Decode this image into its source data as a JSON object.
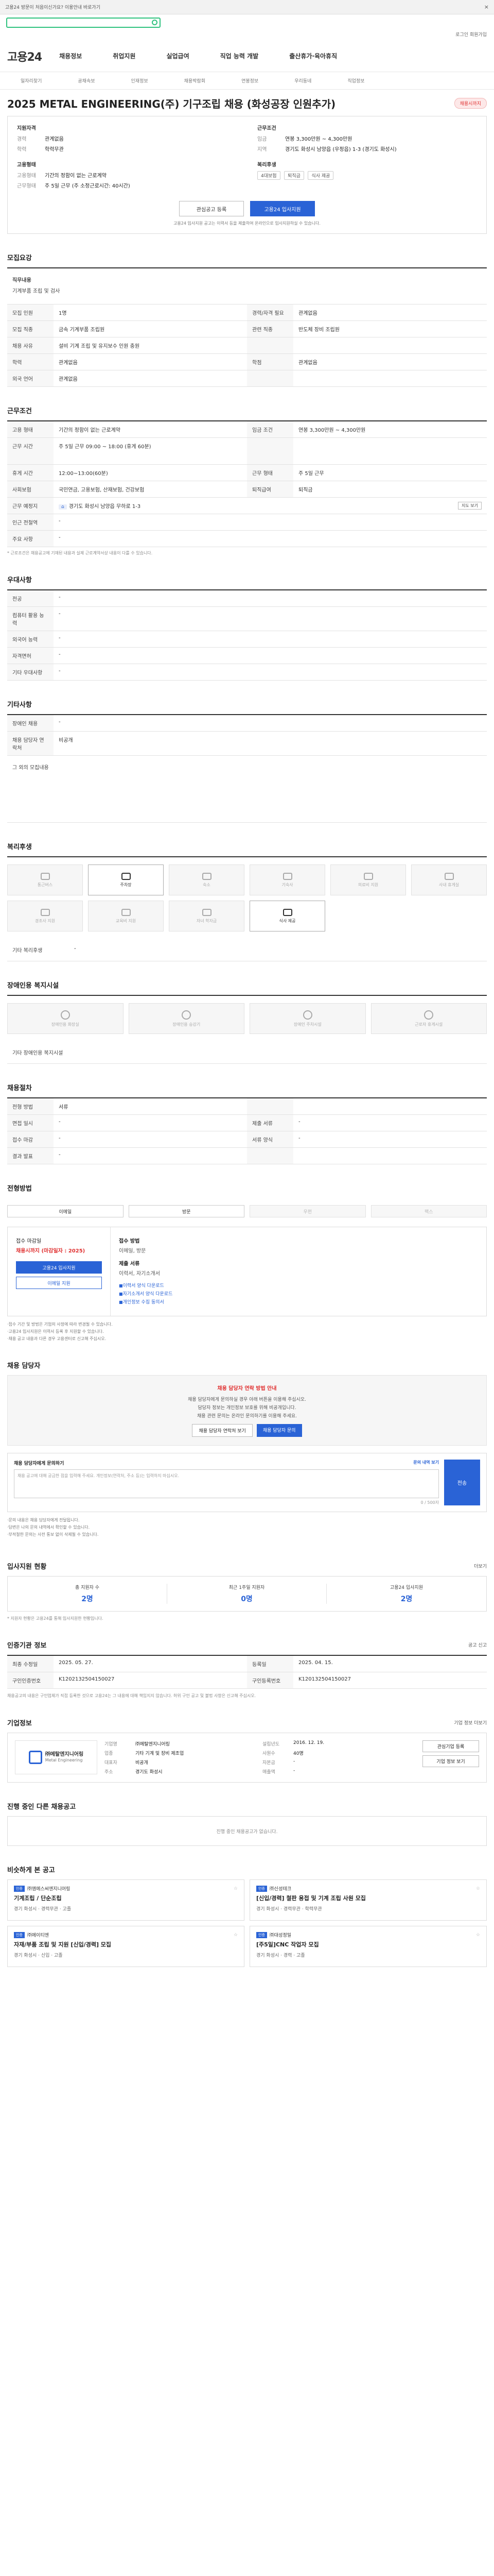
{
  "top": {
    "banner": "고용24 방문이 처음이신가요? 이용안내 바로가기",
    "util": "로그인   회원가입"
  },
  "brand": {
    "name": "고용24"
  },
  "gnb": [
    "채용정보",
    "취업지원",
    "실업급여",
    "직업 능력 개발",
    "출산휴가·육아휴직"
  ],
  "subnav": [
    "일자리찾기",
    "공채속보",
    "인재정보",
    "채용박람회",
    "연봉정보",
    "우리동네",
    "직업정보"
  ],
  "job": {
    "title": "2025 METAL ENGINEERING(주) 기구조립 채용 (화성공장 인원추가)",
    "status_badge": "채용시까지",
    "summary": {
      "left_head": "지원자격",
      "career_k": "경력",
      "career_v": "관계없음",
      "edu_k": "학력",
      "edu_v": "학력무관",
      "cond_head": "고용형태",
      "type_k": "고용형태",
      "type_v": "기간의 정함이 없는 근로계약",
      "hours_k": "근무형태",
      "hours_v": "주 5일 근무 (주 소정근로시간: 40시간)",
      "right_head": "근무조건",
      "pay_k": "임금",
      "pay_v": "연봉 3,300만원 ~ 4,300만원",
      "loc_k": "지역",
      "loc_v": "경기도 화성시 남양읍 (우정읍) 1-3 (경기도 화성시)",
      "welfare_head": "복리후생",
      "welfare_pills": [
        "4대보험",
        "퇴직금",
        "식사 제공"
      ]
    },
    "btn_scrap": "관심공고 등록",
    "btn_apply": "고용24 입사지원",
    "apply_note": "고용24 입사지원 공고는 이력서 등을 제출하여 온라인으로 입사지원하실 수 있습니다."
  },
  "sections": {
    "duty": "모집요강",
    "duty_head": "직무내용",
    "duty_text": "기계부품 조립 및 검사",
    "conditions": "근무조건",
    "preferred": "우대사항",
    "etc": "기타사항",
    "welfare": "복리후생",
    "disability": "장애인용 복지시설",
    "recruitment": "채용절차",
    "method": "전형방법",
    "manager": "채용 담당자",
    "stats": "입사지원 현황",
    "info": "인증기관 정보",
    "company": "기업정보",
    "related": "진행 중인 다른 채용공고",
    "similar": "비슷하게 본 공고"
  },
  "duty_rows": [
    [
      "모집 인원",
      "1명",
      "경력/자격 필요",
      "관계없음"
    ],
    [
      "모집 직종",
      "금속 기계부품 조립원",
      "관련 직종",
      "반도체 장비 조립원"
    ],
    [
      "채용 사유",
      "설비 기계 조립 및 유지보수 인원 충원",
      "",
      ""
    ],
    [
      "학력",
      "관계없음",
      "학점",
      "관계없음"
    ],
    [
      "외국 언어",
      "관계없음",
      "",
      ""
    ]
  ],
  "cond_rows": [
    [
      "고용 형태",
      "기간의 정함이 없는 근로계약",
      "임금 조건",
      "연봉 3,300만원 ~ 4,300만원"
    ],
    [
      "근무 시간",
      "주 5일 근무 09:00 ~ 18:00 (휴게 60분)",
      "",
      ""
    ],
    [
      "휴게 시간",
      "12:00~13:00(60분)",
      "근무 형태",
      "주 5일 근무"
    ],
    [
      "사회보험",
      "국민연금, 고용보험, 산재보험, 건강보험",
      "퇴직급여",
      "퇴직금"
    ]
  ],
  "loc_row": {
    "k": "근무 예정지",
    "v": "경기도 화성시 남양읍 무하로 1-3",
    "map": "지도 보기"
  },
  "cond_extra": [
    [
      "인근 전철역",
      "-"
    ],
    [
      "주요 사항",
      "-"
    ]
  ],
  "cond_note": "* 근로조건은 채용공고에 기재된 내용과 실제 근로계약서상 내용이 다를 수 있습니다.",
  "pref_rows": [
    [
      "전공",
      "-"
    ],
    [
      "컴퓨터 활용 능력",
      "-"
    ],
    [
      "외국어 능력",
      "-"
    ],
    [
      "자격면허",
      "-"
    ],
    [
      "기타 우대사항",
      "-"
    ]
  ],
  "etc_rows": [
    [
      "장애인 채용",
      "-"
    ],
    [
      "채용 담당자 연락처",
      "비공개"
    ]
  ],
  "etc_link": "그 외의 모집내용",
  "welfare_items": [
    {
      "label": "통근버스",
      "on": false
    },
    {
      "label": "주차장",
      "on": true
    },
    {
      "label": "숙소",
      "on": false
    },
    {
      "label": "기숙사",
      "on": false
    },
    {
      "label": "의료비 지원",
      "on": false
    },
    {
      "label": "사내 휴게실",
      "on": false
    },
    {
      "label": "경조사 지원",
      "on": false
    },
    {
      "label": "교육비 지원",
      "on": false
    },
    {
      "label": "자녀 학자금",
      "on": false
    },
    {
      "label": "식사 제공",
      "on": true
    }
  ],
  "welfare_etc": {
    "k": "기타 복리후생",
    "v": "-"
  },
  "dis_items": [
    "장애인용 화장실",
    "장애인용 승강기",
    "장애인 주차시설",
    "근로자 휴게시설"
  ],
  "dis_etc": {
    "k": "기타 장애인용 복지시설",
    "v": ""
  },
  "rec_rows": [
    [
      "전형 방법",
      "서류",
      "",
      ""
    ],
    [
      "면접 일시",
      "-",
      "제출 서류",
      "-"
    ],
    [
      "접수 마감",
      "-",
      "서류 양식",
      "-"
    ],
    [
      "결과 발표",
      "-",
      "",
      ""
    ]
  ],
  "methods": [
    {
      "label": "이메일",
      "off": false
    },
    {
      "label": "방문",
      "off": false
    },
    {
      "label": "우편",
      "off": true
    },
    {
      "label": "팩스",
      "off": true
    }
  ],
  "apply": {
    "deadline_label": "접수 마감일",
    "deadline": "채용시까지 (마감일자 : 2025)",
    "btn1": "고용24 입사지원",
    "btn2": "이메일 지원",
    "right_title": "접수 방법",
    "right_text": "이메일, 방문",
    "doc_title": "제출 서류",
    "doc_text": "이력서, 자기소개서",
    "files": [
      "이력서 양식 다운로드",
      "자기소개서 양식 다운로드",
      "개인정보 수집 동의서"
    ],
    "notes": [
      "접수 기간 및 방법은 기업의 사정에 따라 변경될 수 있습니다.",
      "고용24 입사지원은 이력서 등록 후 지원할 수 있습니다.",
      "채용 공고 내용과 다른 경우 고용센터로 신고해 주십시오."
    ]
  },
  "manager": {
    "warn": "채용 담당자 연락 방법 안내",
    "line1": "채용 담당자에게 문의하실 경우 아래 버튼을 이용해 주십시오.",
    "line2": "담당자 정보는 개인정보 보호를 위해 비공개입니다.",
    "line3": "채용 관련 문의는 온라인 문의하기를 이용해 주세요.",
    "btn1": "채용 담당자 연락처 보기",
    "btn2": "채용 담당자 문의"
  },
  "ask": {
    "label": "채용 담당자에게 문의하기",
    "link": "문의 내역 보기",
    "placeholder": "채용 공고에 대해 궁금한 점을 입력해 주세요. 개인정보(연락처, 주소 등)는 입력하지 마십시오.",
    "count": "0 / 500자",
    "btn": "전송",
    "notes": [
      "문의 내용은 채용 담당자에게 전달됩니다.",
      "답변은 나의 문의 내역에서 확인할 수 있습니다.",
      "부적절한 문의는 사전 통보 없이 삭제될 수 있습니다."
    ]
  },
  "stats": {
    "more": "더보기",
    "items": [
      {
        "label": "총 지원자 수",
        "value": "2명"
      },
      {
        "label": "최근 1주일 지원자",
        "value": "0명"
      },
      {
        "label": "고용24 입사지원",
        "value": "2명"
      }
    ],
    "note": "* 지원자 현황은 고용24를 통해 입사지원한 현황입니다."
  },
  "info_rows": [
    [
      "최종 수정일",
      "2025. 05. 27.",
      "등록일",
      "2025. 04. 15."
    ],
    [
      "구인인증번호",
      "K1202132504150027",
      "구인등록번호",
      "K120132504150027"
    ]
  ],
  "info_btn": "공고 신고",
  "info_disclaimer": "채용공고의 내용은 구인업체가 직접 등록한 것으로 고용24는 그 내용에 대해 책임지지 않습니다. 허위 구인 공고 및 불법 사항은 신고해 주십시오.",
  "company": {
    "more": "기업 정보 더보기",
    "logo_name": "㈜메탈엔지니어링",
    "logo_sub": "Metal Engineering",
    "rows": [
      [
        "기업명",
        "㈜메탈엔지니어링",
        "설립년도",
        "2016. 12. 19."
      ],
      [
        "업종",
        "기타 기계 및 장비 제조업",
        "사원수",
        "40명"
      ],
      [
        "대표자",
        "비공개",
        "자본금",
        "-"
      ],
      [
        "주소",
        "경기도 화성시",
        "매출액",
        "-"
      ]
    ],
    "btn1": "관심기업 등록",
    "btn2": "기업 정보 보기"
  },
  "related_empty": "진행 중인 채용공고가 없습니다.",
  "similar": [
    {
      "tag": "인증",
      "co": "㈜엠에스씨엔지니어링",
      "title": "기계조립 / 단순조립",
      "meta": "경기 화성시 · 경력무관 · 고졸"
    },
    {
      "tag": "인증",
      "co": "㈜신성테크",
      "title": "[신입/경력] 철판 용접 및 기계 조립 사원 모집",
      "meta": "경기 화성시 · 경력무관 · 학력무관"
    },
    {
      "tag": "인증",
      "co": "㈜에이티엔",
      "title": "자재/부품 조립 및 지원 [신입/경력] 모집",
      "meta": "경기 화성시 · 신입 · 고졸"
    },
    {
      "tag": "인증",
      "co": "㈜대성정밀",
      "title": "[주5일]CNC 작업자 모집",
      "meta": "경기 화성시 · 경력 · 고졸"
    }
  ]
}
